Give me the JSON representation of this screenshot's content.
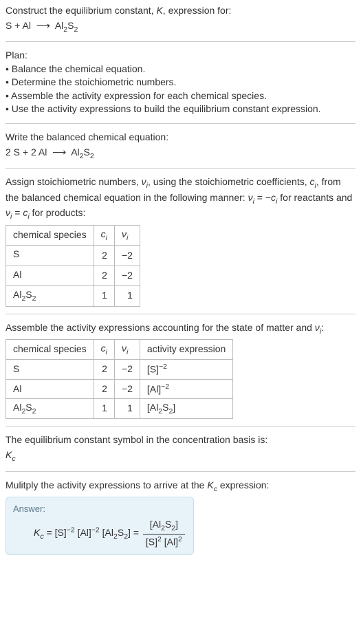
{
  "intro": {
    "line1a": "Construct the equilibrium constant, ",
    "K": "K",
    "line1b": ", expression for:",
    "reaction_lhs": "S + Al",
    "arrow": "⟶",
    "reaction_rhs_a": "Al",
    "reaction_rhs_b": "2",
    "reaction_rhs_c": "S",
    "reaction_rhs_d": "2"
  },
  "plan": {
    "title": "Plan:",
    "b1": "• Balance the chemical equation.",
    "b2": "• Determine the stoichiometric numbers.",
    "b3": "• Assemble the activity expression for each chemical species.",
    "b4": "• Use the activity expressions to build the equilibrium constant expression."
  },
  "balanced": {
    "title": "Write the balanced chemical equation:",
    "lhs": "2 S + 2 Al",
    "arrow": "⟶",
    "rhs_a": "Al",
    "rhs_b": "2",
    "rhs_c": "S",
    "rhs_d": "2"
  },
  "assign": {
    "t1": "Assign stoichiometric numbers, ",
    "vi": "ν",
    "visub": "i",
    "t2": ", using the stoichiometric coefficients, ",
    "ci": "c",
    "cisub": "i",
    "t3": ", from the balanced chemical equation in the following manner: ",
    "eq1a": "ν",
    "eq1b": "i",
    "eq1c": " = −",
    "eq1d": "c",
    "eq1e": "i",
    "t4": " for reactants and ",
    "eq2a": "ν",
    "eq2b": "i",
    "eq2c": " = ",
    "eq2d": "c",
    "eq2e": "i",
    "t5": " for products:"
  },
  "table1": {
    "h1": "chemical species",
    "h2a": "c",
    "h2b": "i",
    "h3a": "ν",
    "h3b": "i",
    "rows": [
      {
        "sp_a": "S",
        "sp_b": "",
        "sp_c": "",
        "sp_d": "",
        "c": "2",
        "v": "−2"
      },
      {
        "sp_a": "Al",
        "sp_b": "",
        "sp_c": "",
        "sp_d": "",
        "c": "2",
        "v": "−2"
      },
      {
        "sp_a": "Al",
        "sp_b": "2",
        "sp_c": "S",
        "sp_d": "2",
        "c": "1",
        "v": "1"
      }
    ]
  },
  "assemble": {
    "t1": "Assemble the activity expressions accounting for the state of matter and ",
    "v": "ν",
    "vsub": "i",
    "t2": ":"
  },
  "table2": {
    "h1": "chemical species",
    "h2a": "c",
    "h2b": "i",
    "h3a": "ν",
    "h3b": "i",
    "h4": "activity expression",
    "rows": [
      {
        "sp_a": "S",
        "sp_b": "",
        "sp_c": "",
        "sp_d": "",
        "c": "2",
        "v": "−2",
        "ax_a": "[S]",
        "ax_b": "−2"
      },
      {
        "sp_a": "Al",
        "sp_b": "",
        "sp_c": "",
        "sp_d": "",
        "c": "2",
        "v": "−2",
        "ax_a": "[Al]",
        "ax_b": "−2"
      },
      {
        "sp_a": "Al",
        "sp_b": "2",
        "sp_c": "S",
        "sp_d": "2",
        "c": "1",
        "v": "1",
        "ax_a": "[Al",
        "ax_b": "",
        "ax_c": "2",
        "ax_d": "S",
        "ax_e": "2",
        "ax_f": "]"
      }
    ]
  },
  "basis": {
    "t": "The equilibrium constant symbol in the concentration basis is:",
    "K": "K",
    "Ksub": "c"
  },
  "mult": {
    "t1": "Mulitply the activity expressions to arrive at the ",
    "K": "K",
    "Ksub": "c",
    "t2": " expression:"
  },
  "answer": {
    "label": "Answer:",
    "Kc_a": "K",
    "Kc_b": "c",
    "eq": " = ",
    "p1_a": "[S]",
    "p1_b": "−2",
    "p2_a": "[Al]",
    "p2_b": "−2",
    "p3_a": "[Al",
    "p3_b": "2",
    "p3_c": "S",
    "p3_d": "2",
    "p3_e": "]",
    "eq2": " = ",
    "num_a": "[Al",
    "num_b": "2",
    "num_c": "S",
    "num_d": "2",
    "num_e": "]",
    "den_a": "[S]",
    "den_b": "2",
    "den_c": " [Al]",
    "den_d": "2"
  }
}
